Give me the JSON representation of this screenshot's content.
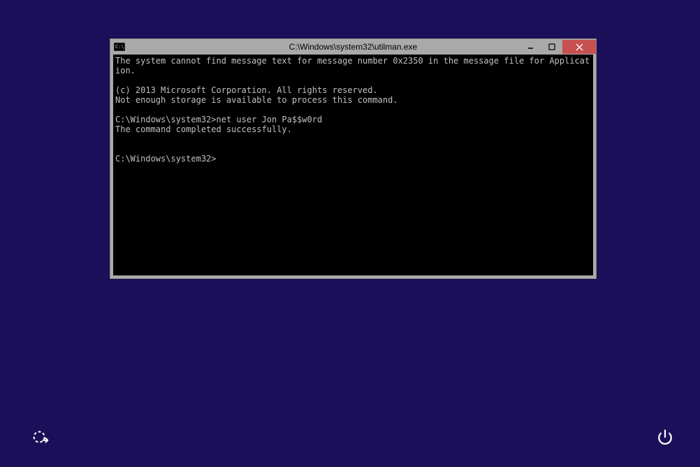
{
  "window": {
    "title": "C:\\Windows\\system32\\utilman.exe",
    "buttons": {
      "minimize": "–",
      "maximize": "▢",
      "close": "×"
    }
  },
  "console": {
    "lines": [
      "The system cannot find message text for message number 0x2350 in the message file for Application.",
      "",
      "(c) 2013 Microsoft Corporation. All rights reserved.",
      "Not enough storage is available to process this command.",
      "",
      "C:\\Windows\\system32>net user Jon Pa$$w0rd",
      "The command completed successfully.",
      "",
      "",
      "C:\\Windows\\system32>"
    ]
  },
  "corner": {
    "ease_label": "Ease of access",
    "power_label": "Power"
  }
}
